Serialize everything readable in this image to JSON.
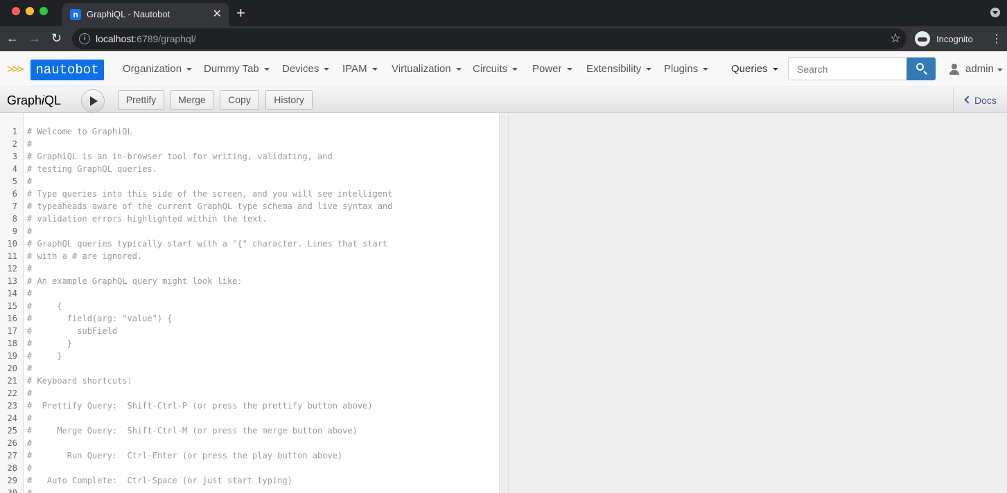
{
  "browser": {
    "tab_title": "GraphiQL - Nautobot",
    "tab_favicon": "n",
    "url_host": "localhost",
    "url_path": ":6789/graphql/",
    "profile_label": "Incognito"
  },
  "navbar": {
    "logo_text": "nautobot",
    "logo_chevrons": ">>>",
    "menus": [
      "Organization",
      "Dummy Tab",
      "Devices",
      "IPAM",
      "Virtualization",
      "Circuits",
      "Power",
      "Extensibility",
      "Plugins",
      "Queries"
    ],
    "search_placeholder": "Search",
    "user": "admin"
  },
  "graphiql": {
    "title_pre": "Graph",
    "title_i": "i",
    "title_post": "QL",
    "buttons": [
      "Prettify",
      "Merge",
      "Copy",
      "History"
    ],
    "docs_label": "Docs"
  },
  "editor": {
    "lines": [
      "# Welcome to GraphiQL",
      "#",
      "# GraphiQL is an in-browser tool for writing, validating, and",
      "# testing GraphQL queries.",
      "#",
      "# Type queries into this side of the screen, and you will see intelligent",
      "# typeaheads aware of the current GraphQL type schema and live syntax and",
      "# validation errors highlighted within the text.",
      "#",
      "# GraphQL queries typically start with a \"{\" character. Lines that start",
      "# with a # are ignored.",
      "#",
      "# An example GraphQL query might look like:",
      "#",
      "#     {",
      "#       field(arg: \"value\") {",
      "#         subField",
      "#       }",
      "#     }",
      "#",
      "# Keyboard shortcuts:",
      "#",
      "#  Prettify Query:  Shift-Ctrl-P (or press the prettify button above)",
      "#",
      "#     Merge Query:  Shift-Ctrl-M (or press the merge button above)",
      "#",
      "#       Run Query:  Ctrl-Enter (or press the play button above)",
      "#",
      "#   Auto Complete:  Ctrl-Space (or just start typing)",
      "#"
    ]
  }
}
